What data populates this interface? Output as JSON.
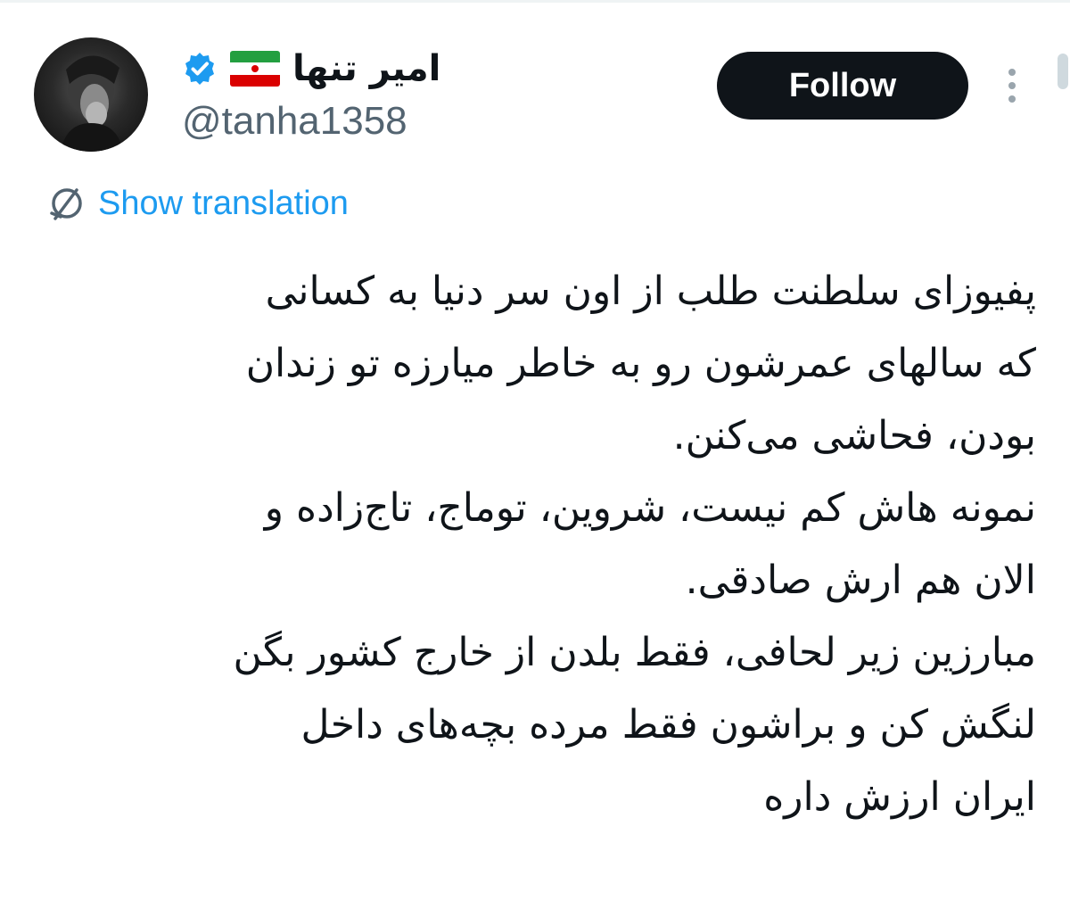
{
  "user": {
    "display_name": "امیر تنها",
    "handle": "@tanha1358",
    "flag_icon": "iran-flag-icon",
    "verified_icon": "verified-badge-icon",
    "verified_color": "#1d9bf0"
  },
  "actions": {
    "follow_label": "Follow",
    "more_icon": "more-vertical-icon"
  },
  "translation": {
    "link_label": "Show translation",
    "icon": "globe-icon",
    "link_color": "#1d9bf0"
  },
  "tweet": {
    "lines": [
      "پفیوزای سلطنت طلب از اون سر دنیا به کسانی",
      "که سالهای عمرشون رو به خاطر میارزه تو زندان",
      "بودن، فحاشی می‌کنن.",
      "نمونه هاش کم نیست، شروین، توماج، تاج‌زاده و",
      "الان هم ارش صادقی.",
      "مبارزین زیر لحافی، فقط بلدن از خارج کشور بگن",
      "لنگش کن و براشون فقط مرده بچه‌های داخل",
      "ایران ارزش داره"
    ]
  }
}
